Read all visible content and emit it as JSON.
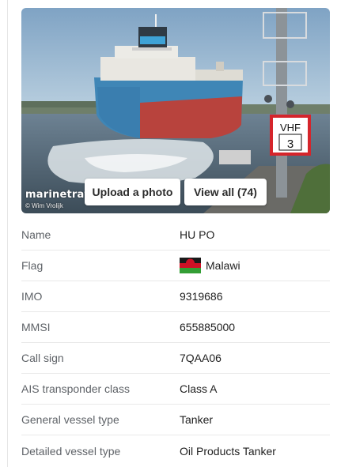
{
  "photo": {
    "watermark": "marinetraffic",
    "credit": "© Wim Vrolijk",
    "sign_text": "VHF",
    "sign_number": "3",
    "upload_label": "Upload a photo",
    "view_all_label": "View all (74)"
  },
  "details": [
    {
      "label": "Name",
      "value": "HU PO"
    },
    {
      "label": "Flag",
      "value": "Malawi",
      "icon": "malawi-flag-icon"
    },
    {
      "label": "IMO",
      "value": "9319686"
    },
    {
      "label": "MMSI",
      "value": "655885000"
    },
    {
      "label": "Call sign",
      "value": "7QAA06"
    },
    {
      "label": "AIS transponder class",
      "value": "Class A"
    },
    {
      "label": "General vessel type",
      "value": "Tanker"
    },
    {
      "label": "Detailed vessel type",
      "value": "Oil Products Tanker"
    }
  ],
  "colors": {
    "hull_blue": "#3f86b6",
    "hull_red": "#b8433d",
    "sign_red": "#d5252b"
  }
}
